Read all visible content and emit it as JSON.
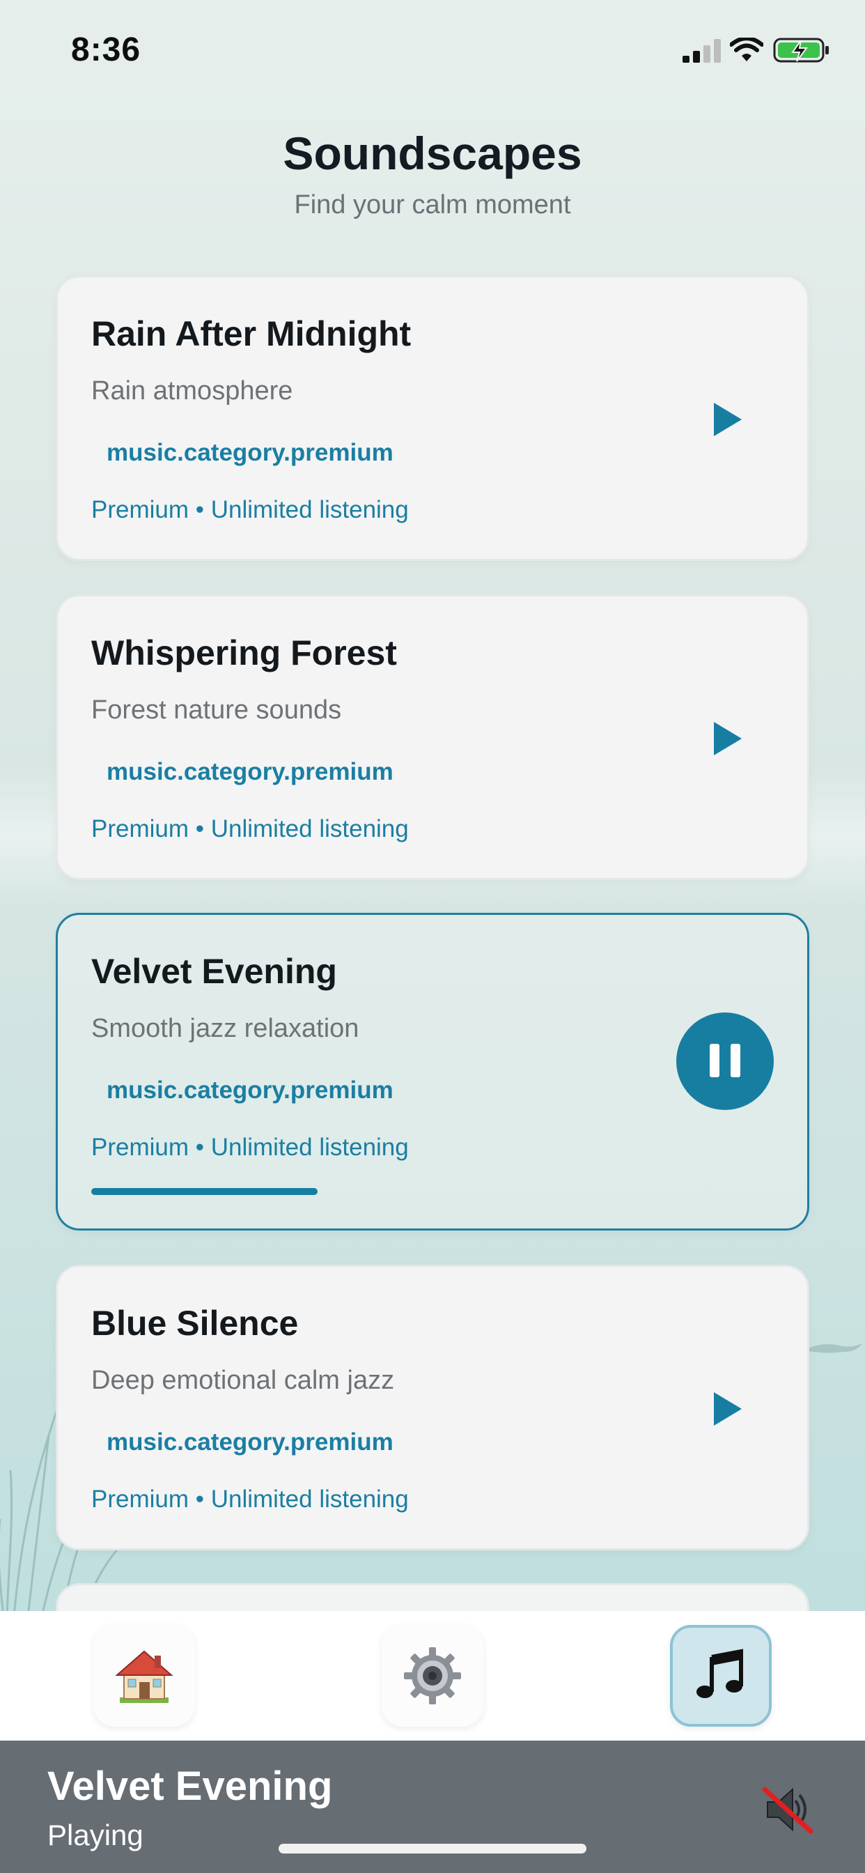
{
  "status_bar": {
    "time": "8:36"
  },
  "header": {
    "title": "Soundscapes",
    "subtitle": "Find your calm moment"
  },
  "tracks": [
    {
      "title": "Rain After Midnight",
      "description": "Rain atmosphere",
      "category": "music.category.premium",
      "meta": "Premium • Unlimited listening",
      "state": "play",
      "action_icon": "play-icon"
    },
    {
      "title": "Whispering Forest",
      "description": "Forest nature sounds",
      "category": "music.category.premium",
      "meta": "Premium • Unlimited listening",
      "state": "play",
      "action_icon": "play-icon"
    },
    {
      "title": "Velvet Evening",
      "description": "Smooth jazz relaxation",
      "category": "music.category.premium",
      "meta": "Premium • Unlimited listening",
      "state": "playing",
      "action_icon": "pause-icon",
      "progress": 0.33
    },
    {
      "title": "Blue Silence",
      "description": "Deep emotional calm jazz",
      "category": "music.category.premium",
      "meta": "Premium • Unlimited listening",
      "state": "play",
      "action_icon": "play-icon"
    }
  ],
  "tab_bar": {
    "tabs": [
      {
        "icon": "house-icon",
        "active": false
      },
      {
        "icon": "gear-icon",
        "active": false
      },
      {
        "icon": "music-note-icon",
        "active": true
      }
    ]
  },
  "now_playing": {
    "title": "Velvet Evening",
    "status": "Playing",
    "icon": "speaker-muted-icon"
  },
  "colors": {
    "accent": "#177ea2",
    "card_background": "#f4f4f4",
    "now_playing_background": "#666d73"
  }
}
